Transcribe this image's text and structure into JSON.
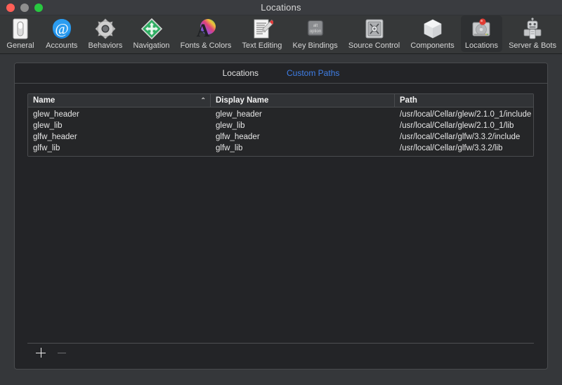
{
  "window": {
    "title": "Locations",
    "traffic_lights": [
      {
        "name": "close-button",
        "color": "#ff5f57"
      },
      {
        "name": "minimize-button",
        "color": "#8e8e8e"
      },
      {
        "name": "zoom-button",
        "color": "#28c840"
      }
    ]
  },
  "toolbar": {
    "items": [
      {
        "label": "General",
        "icon": "general-icon",
        "selected": false
      },
      {
        "label": "Accounts",
        "icon": "accounts-icon",
        "selected": false
      },
      {
        "label": "Behaviors",
        "icon": "behaviors-icon",
        "selected": false
      },
      {
        "label": "Navigation",
        "icon": "navigation-icon",
        "selected": false
      },
      {
        "label": "Fonts & Colors",
        "icon": "fonts-and-colors-icon",
        "selected": false
      },
      {
        "label": "Text Editing",
        "icon": "text-editing-icon",
        "selected": false
      },
      {
        "label": "Key Bindings",
        "icon": "key-bindings-icon",
        "selected": false
      },
      {
        "label": "Source Control",
        "icon": "source-control-icon",
        "selected": false
      },
      {
        "label": "Components",
        "icon": "components-icon",
        "selected": false
      },
      {
        "label": "Locations",
        "icon": "locations-icon",
        "selected": true
      },
      {
        "label": "Server & Bots",
        "icon": "server-and-bots-icon",
        "selected": false
      }
    ]
  },
  "tabs": [
    {
      "label": "Locations",
      "active": false
    },
    {
      "label": "Custom Paths",
      "active": true
    }
  ],
  "table": {
    "columns": [
      {
        "key": "name",
        "label": "Name",
        "sorted": "ascending",
        "sort_glyph": "⌃"
      },
      {
        "key": "display",
        "label": "Display Name",
        "sorted": "none"
      },
      {
        "key": "path",
        "label": "Path",
        "sorted": "none"
      }
    ],
    "rows": [
      {
        "name": "glew_header",
        "display": "glew_header",
        "path": "/usr/local/Cellar/glew/2.1.0_1/include"
      },
      {
        "name": "glew_lib",
        "display": "glew_lib",
        "path": "/usr/local/Cellar/glew/2.1.0_1/lib"
      },
      {
        "name": "glfw_header",
        "display": "glfw_header",
        "path": "/usr/local/Cellar/glfw/3.3.2/include"
      },
      {
        "name": "glfw_lib",
        "display": "glfw_lib",
        "path": "/usr/local/Cellar/glfw/3.3.2/lib"
      }
    ]
  },
  "bottom_bar": {
    "add_button": {
      "name": "add-path-button",
      "glyph": "+",
      "enabled": true
    },
    "remove_button": {
      "name": "remove-path-button",
      "glyph": "−",
      "enabled": false
    }
  },
  "colors": {
    "window_chrome": "#35373a",
    "toolbar": "#363839",
    "panel_bg": "#232427",
    "table_bg": "#252628",
    "header_bg": "#313336",
    "border": "#4a4c4f",
    "accent_blue": "#3f7fe8",
    "text_primary": "#e6e6e6"
  }
}
